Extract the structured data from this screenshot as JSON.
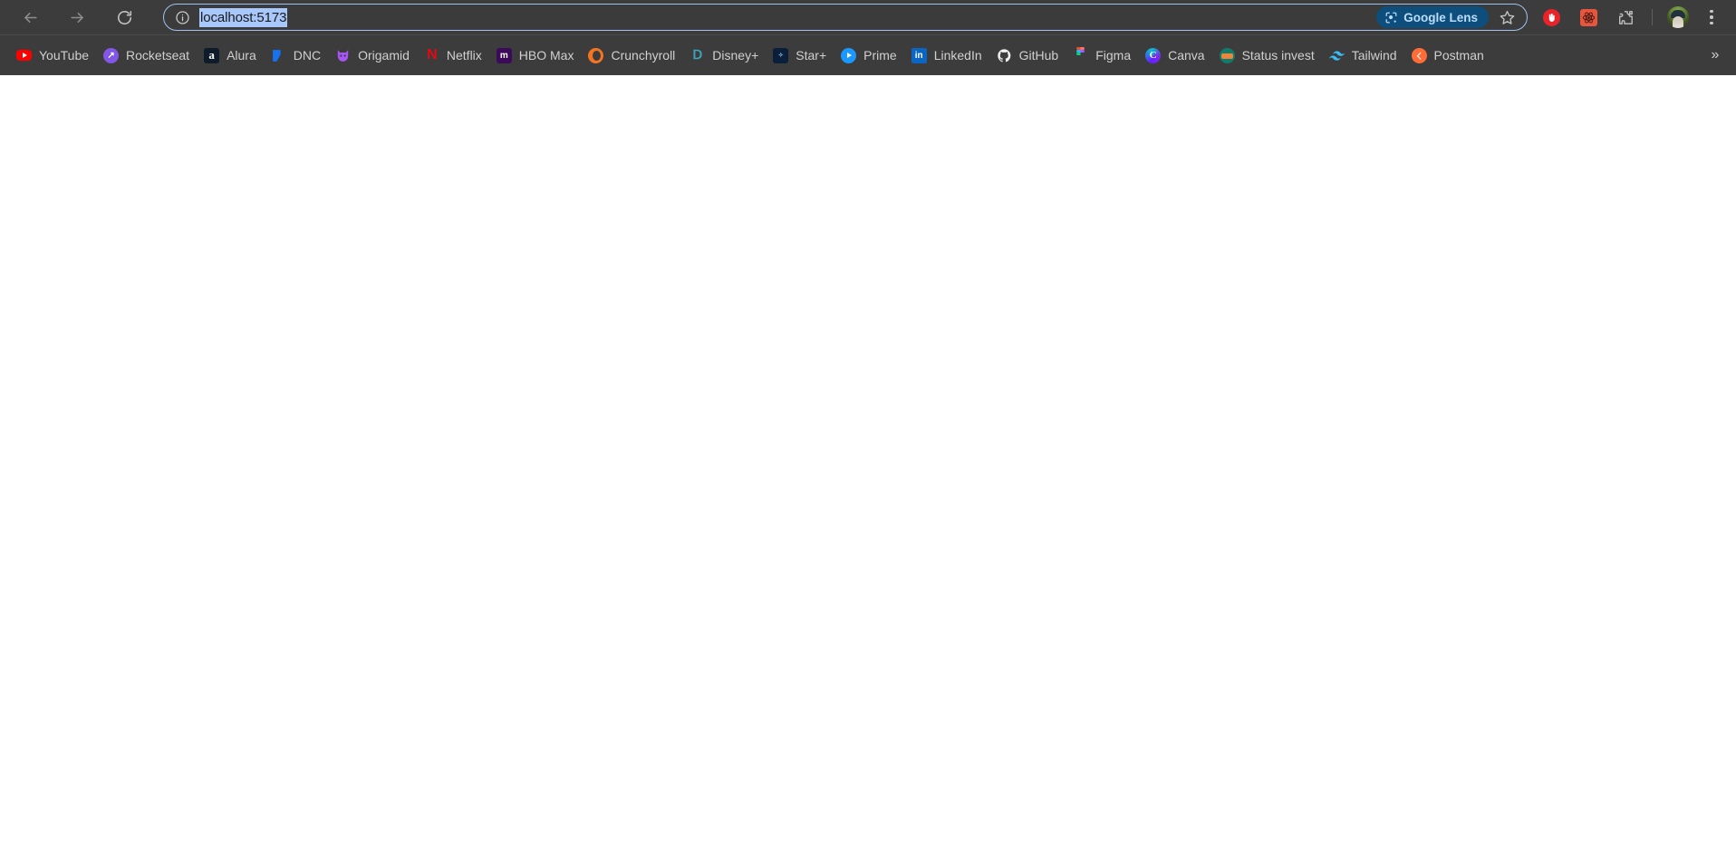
{
  "browser": {
    "back_tooltip": "Back",
    "forward_tooltip": "Forward",
    "reload_tooltip": "Reload this page",
    "site_info_tooltip": "View site information",
    "url_value": "localhost:5173",
    "url_placeholder": "Search Google or type a URL",
    "lens_label": "Google Lens",
    "bookmark_star_tooltip": "Bookmark this tab",
    "extensions": [
      {
        "name": "ublock-origin",
        "tooltip": "uBlock Origin",
        "color": "#e8242a"
      },
      {
        "name": "react-developer-tools",
        "tooltip": "React Developer Tools",
        "color": "#e8553d"
      },
      {
        "name": "extensions-puzzle",
        "tooltip": "Extensions",
        "color": "#c9c9c9"
      }
    ],
    "profile_tooltip": "Profile",
    "menu_tooltip": "Customize and control Google Chrome",
    "menu_icon": "kebab-menu-icon",
    "toolbar_bg": "#3c3c3c",
    "url_focus_ring": "#9fc3f0",
    "url_selection_bg": "#a8c7fa",
    "lens_bg": "#0d4e7c",
    "lens_text_color": "#bcdcfb"
  },
  "bookmarks": {
    "overflow_label": "»",
    "overflow_tooltip": "Show more bookmarks",
    "items": [
      {
        "label": "YouTube",
        "icon": "youtube-icon"
      },
      {
        "label": "Rocketseat",
        "icon": "rocketseat-icon"
      },
      {
        "label": "Alura",
        "icon": "alura-icon"
      },
      {
        "label": "DNC",
        "icon": "dnc-icon"
      },
      {
        "label": "Origamid",
        "icon": "origamid-icon"
      },
      {
        "label": "Netflix",
        "icon": "netflix-icon"
      },
      {
        "label": "HBO Max",
        "icon": "hbomax-icon"
      },
      {
        "label": "Crunchyroll",
        "icon": "crunchyroll-icon"
      },
      {
        "label": "Disney+",
        "icon": "disneyplus-icon"
      },
      {
        "label": "Star+",
        "icon": "starplus-icon"
      },
      {
        "label": "Prime",
        "icon": "primevideo-icon"
      },
      {
        "label": "LinkedIn",
        "icon": "linkedin-icon"
      },
      {
        "label": "GitHub",
        "icon": "github-icon"
      },
      {
        "label": "Figma",
        "icon": "figma-icon"
      },
      {
        "label": "Canva",
        "icon": "canva-icon"
      },
      {
        "label": "Status invest",
        "icon": "statusinvest-icon"
      },
      {
        "label": "Tailwind",
        "icon": "tailwind-icon"
      },
      {
        "label": "Postman",
        "icon": "postman-icon"
      }
    ]
  },
  "page": {
    "content": "",
    "background": "#ffffff"
  }
}
